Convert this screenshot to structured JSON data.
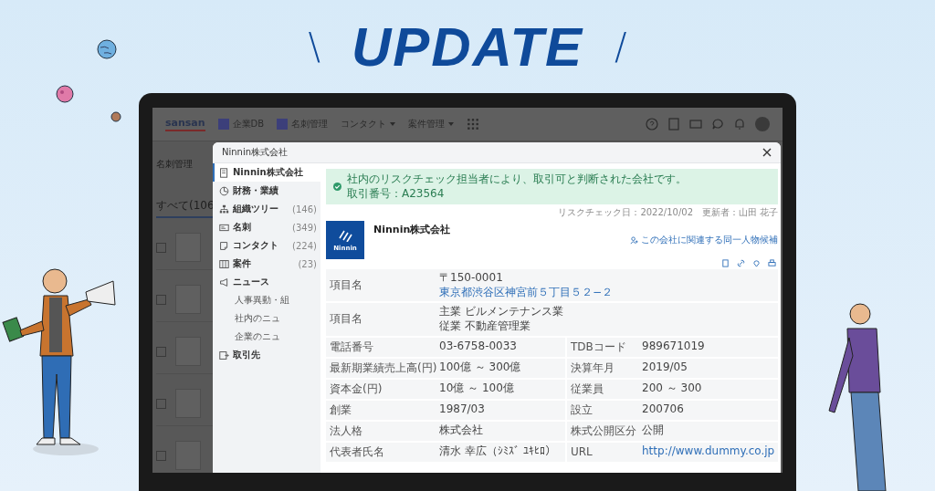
{
  "banner": {
    "left_mark": "\\",
    "title": "UPDATE",
    "right_mark": "/"
  },
  "app": {
    "logo": "sansan",
    "nav": [
      {
        "label": "企業DB",
        "dropdown": false
      },
      {
        "label": "名刺管理",
        "dropdown": false
      },
      {
        "label": "コンタクト",
        "dropdown": true
      },
      {
        "label": "案件管理",
        "dropdown": true
      }
    ],
    "page_title": "名刺管理",
    "tab": "すべて(106",
    "rows": [
      {
        "checked": false
      },
      {
        "checked": false
      },
      {
        "checked": false
      },
      {
        "checked": false
      },
      {
        "checked": false
      }
    ]
  },
  "modal": {
    "title": "Ninnin株式会社",
    "sidebar": [
      {
        "label": "Ninnin株式会社",
        "selected": true
      },
      {
        "label": "財務・業績",
        "selected": false
      },
      {
        "label": "組織ツリー",
        "count": "(146)",
        "selected": false
      },
      {
        "label": "名刺",
        "count": "(349)",
        "selected": false
      },
      {
        "label": "コンタクト",
        "count": "(224)",
        "selected": false
      },
      {
        "label": "案件",
        "count": "(23)",
        "selected": false
      },
      {
        "label": "ニュース",
        "selected": false,
        "children": [
          {
            "label": "人事異動・組",
            "selected": false
          },
          {
            "label": "社内のニュ",
            "selected": false
          },
          {
            "label": "企業のニュ",
            "selected": false
          }
        ]
      },
      {
        "label": "取引先",
        "selected": false
      }
    ],
    "alert": {
      "message": "社内のリスクチェック担当者により、取引可と判断された会社です。",
      "trade_number": "取引番号：A23564"
    },
    "meta": [
      "リスクチェック日：2022/10/02",
      "更新者：山田 花子"
    ],
    "company": {
      "name": "Ninnin株式会社",
      "logo_text": "Ninnin",
      "related_link": "この会社に関連する同一人物候補"
    },
    "table": [
      [
        {
          "label": "項目名",
          "lines": [
            {
              "text": "〒150-0001",
              "link": false
            },
            {
              "text": "東京都渋谷区神宮前５丁目５２−２",
              "link": true
            }
          ]
        }
      ],
      [
        {
          "label": "項目名",
          "lines": [
            {
              "text": "主業 ビルメンテナンス業",
              "link": false
            },
            {
              "text": "従業 不動産管理業",
              "link": false
            }
          ]
        }
      ],
      [
        {
          "label": "電話番号",
          "lines": [
            {
              "text": "03-6758-0033",
              "link": false
            }
          ]
        },
        {
          "label": "TDBコード",
          "lines": [
            {
              "text": "989671019",
              "link": false
            }
          ]
        }
      ],
      [
        {
          "label": "最新期業績売上高(円)",
          "lines": [
            {
              "text": "100億 ～ 300億",
              "link": false
            }
          ]
        },
        {
          "label": "決算年月",
          "lines": [
            {
              "text": "2019/05",
              "link": false
            }
          ]
        }
      ],
      [
        {
          "label": "資本金(円)",
          "lines": [
            {
              "text": "10億 ～ 100億",
              "link": false
            }
          ]
        },
        {
          "label": "従業員",
          "lines": [
            {
              "text": "200 ～ 300",
              "link": false
            }
          ]
        }
      ],
      [
        {
          "label": "創業",
          "lines": [
            {
              "text": "1987/03",
              "link": false
            }
          ]
        },
        {
          "label": "設立",
          "lines": [
            {
              "text": "200706",
              "link": false
            }
          ]
        }
      ],
      [
        {
          "label": "法人格",
          "lines": [
            {
              "text": "株式会社",
              "link": false
            }
          ]
        },
        {
          "label": "株式公開区分",
          "lines": [
            {
              "text": "公開",
              "link": false
            }
          ]
        }
      ],
      [
        {
          "label": "代表者氏名",
          "lines": [
            {
              "text": "清水 幸広（ｼﾐｽﾞ ﾕｷﾋﾛ）",
              "link": false
            }
          ]
        },
        {
          "label": "URL",
          "lines": [
            {
              "text": "http://www.dummy.co.jp",
              "link": true
            }
          ]
        }
      ]
    ]
  }
}
